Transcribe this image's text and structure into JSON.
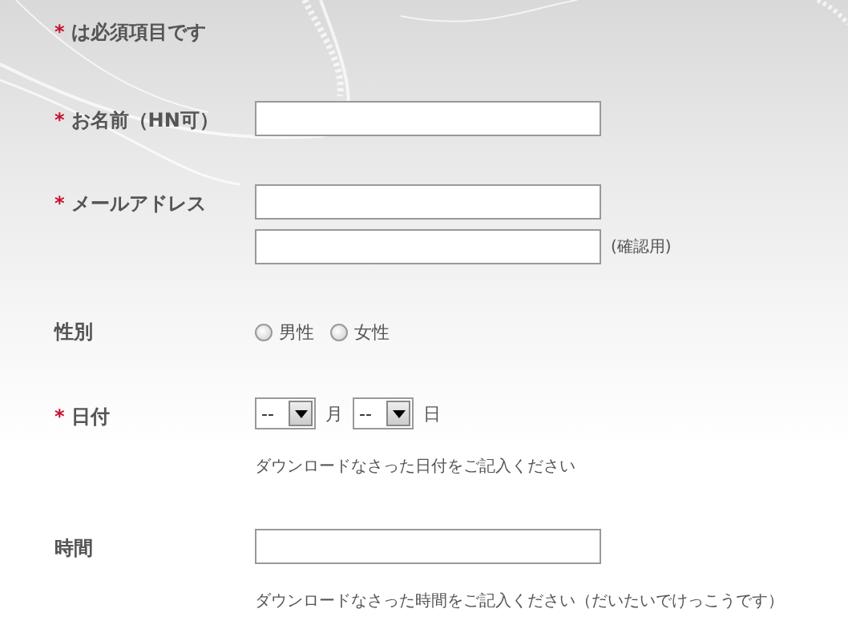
{
  "required_note": {
    "mark": "*",
    "text": "は必須項目です"
  },
  "fields": [
    {
      "kind": "text",
      "mark": "*",
      "label": "お名前（HN可）"
    },
    {
      "kind": "email",
      "mark": "*",
      "label": "メールアドレス",
      "confirm_note": "(確認用)"
    },
    {
      "kind": "radio",
      "label": "性別",
      "options": [
        {
          "label": "男性",
          "selected": false
        },
        {
          "label": "女性",
          "selected": false
        }
      ]
    },
    {
      "kind": "date",
      "mark": "*",
      "label": "日付",
      "selects": [
        {
          "value": "--",
          "unit": "月"
        },
        {
          "value": "--",
          "unit": "日"
        }
      ],
      "hint": "ダウンロードなさった日付をご記入ください"
    },
    {
      "kind": "text",
      "label": "時間",
      "hint": "ダウンロードなさった時間をご記入ください（だいたいでけっこうです）"
    }
  ]
}
